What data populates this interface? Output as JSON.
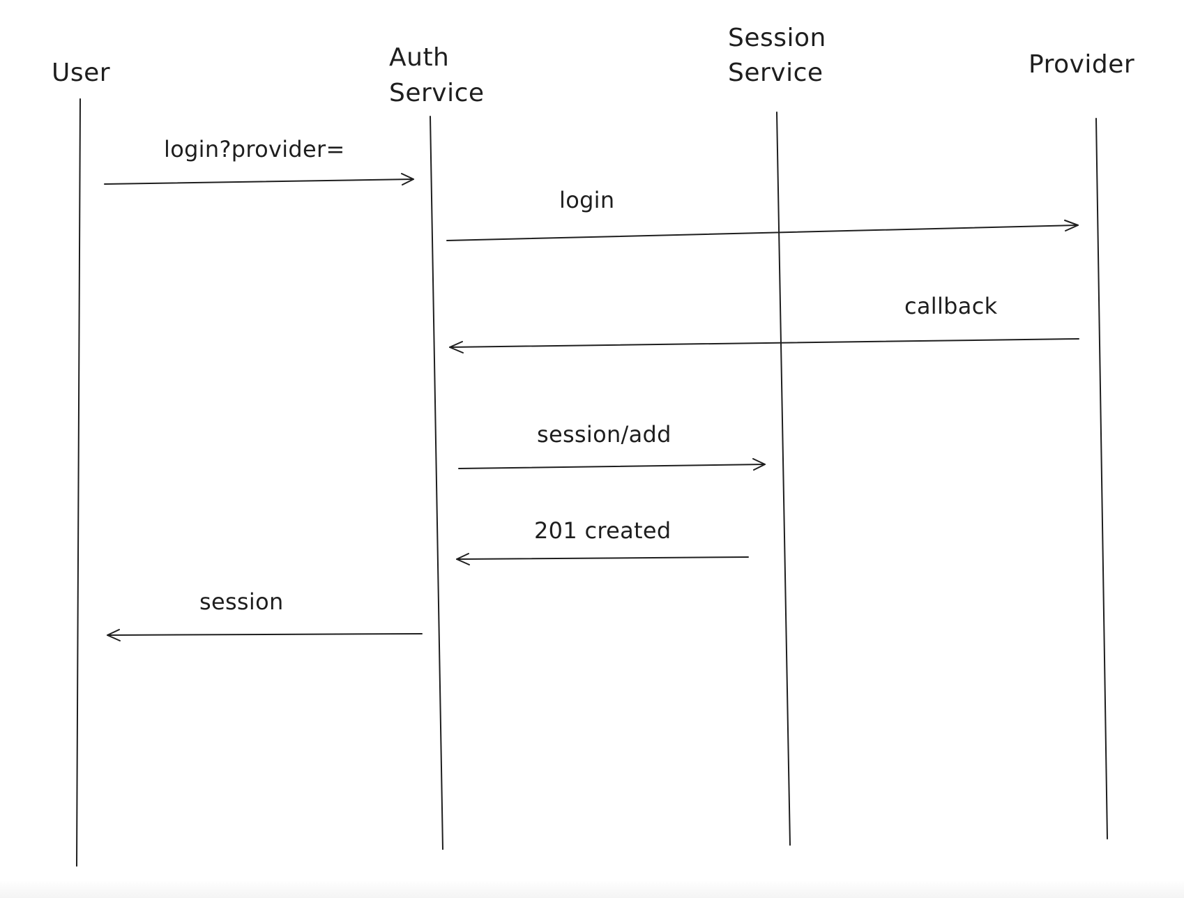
{
  "actors": [
    {
      "id": "user",
      "lines": [
        "User"
      ]
    },
    {
      "id": "auth-service",
      "lines": [
        "Auth",
        "Service"
      ]
    },
    {
      "id": "session-service",
      "lines": [
        "Session",
        "Service"
      ]
    },
    {
      "id": "provider",
      "lines": [
        "Provider"
      ]
    }
  ],
  "messages": [
    {
      "id": "login-provider",
      "label": "login?provider=",
      "from": "User",
      "to": "Auth Service"
    },
    {
      "id": "login",
      "label": "login",
      "from": "Auth Service",
      "to": "Provider"
    },
    {
      "id": "callback",
      "label": "callback",
      "from": "Provider",
      "to": "Auth Service"
    },
    {
      "id": "session-add",
      "label": "session/add",
      "from": "Auth Service",
      "to": "Session Service"
    },
    {
      "id": "created",
      "label": "201 created",
      "from": "Session Service",
      "to": "Auth Service"
    },
    {
      "id": "session",
      "label": "session",
      "from": "Auth Service",
      "to": "User"
    }
  ],
  "colors": {
    "stroke": "#1e1e1e",
    "background": "#ffffff"
  }
}
